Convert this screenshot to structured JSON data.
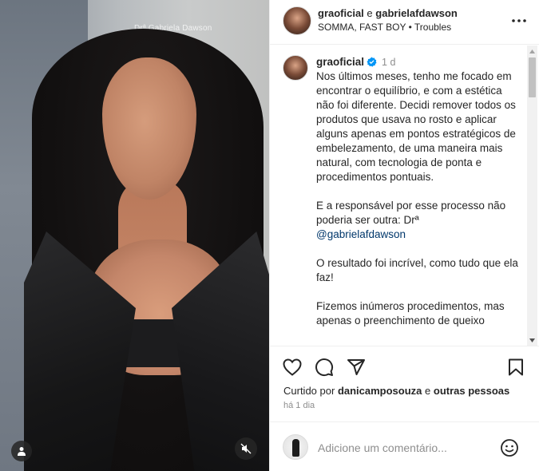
{
  "media": {
    "watermark": "Drª Gabriela Dawson",
    "user_tag_icon": "user-icon",
    "mute_icon": "speaker-muted-icon"
  },
  "header": {
    "username_1": "graoficial",
    "connector": "e",
    "username_2": "gabrielafdawson",
    "audio": "SOMMA, FAST BOY • Troubles",
    "more_icon": "more-horizontal-icon"
  },
  "caption": {
    "username": "graoficial",
    "time": "1 d",
    "paragraphs": [
      "Nos últimos meses, tenho me focado em encontrar o equilíbrio, e com a estética não foi diferente. Decidi remover todos os produtos que usava no rosto e aplicar alguns apenas em pontos estratégicos de embelezamento, de uma maneira mais natural, com tecnologia de ponta e procedimentos pontuais.",
      "E a responsável por esse processo não poderia ser outra: Drª",
      "O resultado foi incrível, como tudo que ela faz!",
      "Fizemos inúmeros procedimentos, mas apenas o preenchimento de queixo"
    ],
    "mention": "@gabrielafdawson"
  },
  "actions": {
    "like_icon": "heart-icon",
    "comment_icon": "comment-icon",
    "share_icon": "share-icon",
    "save_icon": "bookmark-icon"
  },
  "likes": {
    "prefix": "Curtido por",
    "user": "danicamposouza",
    "connector": "e",
    "others": "outras pessoas"
  },
  "post_age": "há 1 dia",
  "comment": {
    "placeholder": "Adicione um comentário...",
    "emoji_icon": "smiley-icon"
  },
  "colors": {
    "text": "#262626",
    "secondary": "#8e8e8e",
    "link": "#00376b",
    "verified": "#0095f6",
    "divider": "#efefef"
  }
}
